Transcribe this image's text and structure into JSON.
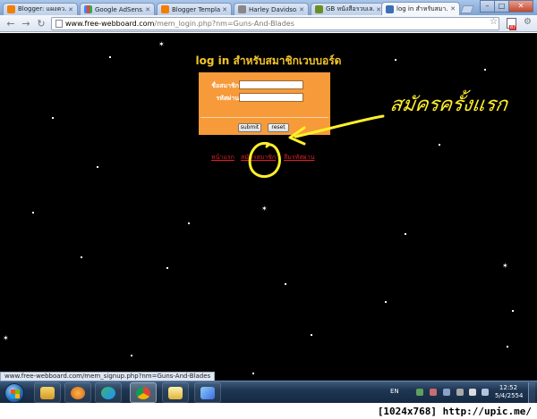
{
  "browser": {
    "tabs": [
      {
        "label": "Blogger: แผงคว..."
      },
      {
        "label": "Google AdSens..."
      },
      {
        "label": "Blogger Templa..."
      },
      {
        "label": "Harley Davidso..."
      },
      {
        "label": "GB หนังสือรวบเล..."
      },
      {
        "label": "log in สำหรับสมา..."
      }
    ],
    "url_host": "www.free-webboard.com",
    "url_path": "/mem_login.php?nm=Guns-And-Blades",
    "extension_badge": "87",
    "status_url": "www.free-webboard.com/mem_signup.php?nm=Guns-And-Blades"
  },
  "page": {
    "title": "log in สำหรับสมาชิกเวบบอร์ด",
    "username_label": "ชื่อสมาชิก",
    "password_label": "รหัสผ่าน",
    "submit_label": "submit",
    "reset_label": "reset",
    "links": {
      "home": "หน้าแรก",
      "signup": "สมัครสมาชิก",
      "forgot": "ลืมรหัสผ่าน"
    },
    "background_color": "#000000",
    "form_color": "#f69a3a",
    "title_color": "#f3c52a",
    "link_color": "#e21f26"
  },
  "annotation": {
    "text": "สมัครครั้งแรก",
    "color": "#ffef2a"
  },
  "taskbar": {
    "language": "EN",
    "time": "12:52",
    "date": "5/4/2554",
    "pinned_icons": [
      "explorer-icon",
      "media-player-icon",
      "chat-icon",
      "chrome-icon",
      "mail-icon",
      "paint-icon"
    ]
  },
  "watermark": "[1024x768] http://upic.me/"
}
